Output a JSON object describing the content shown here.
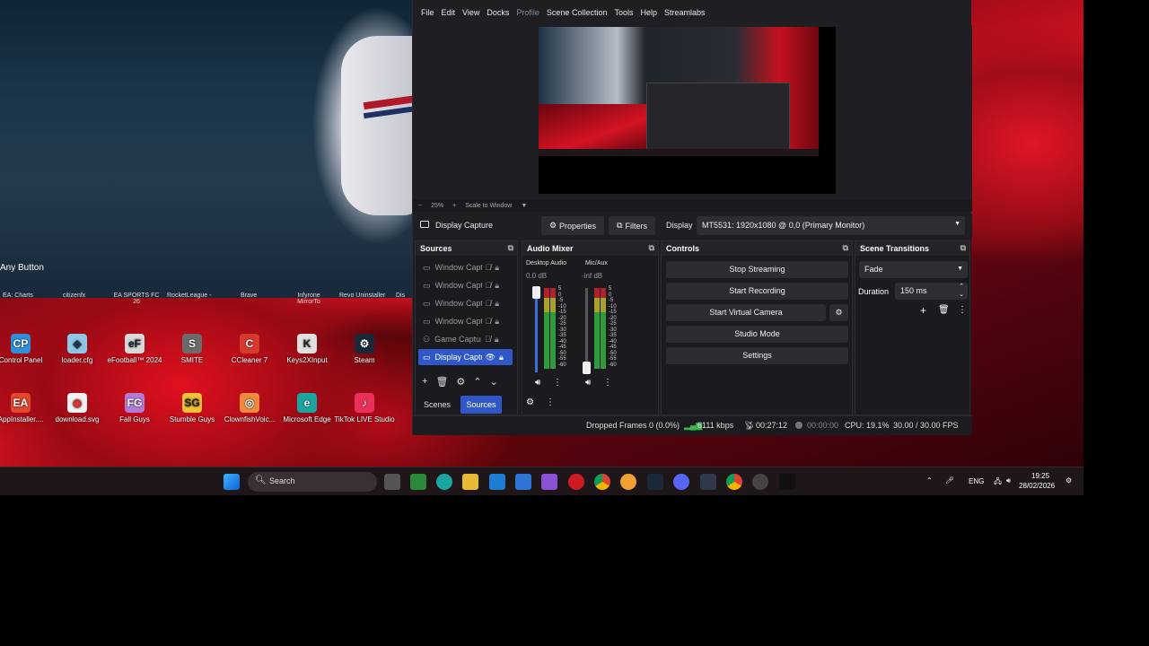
{
  "game": {
    "hint": "Any Button"
  },
  "desktop": {
    "partial_labels": [
      "EA: Charts",
      "citizenfx",
      "EA SPORTS FC 26",
      "RocketLeague -",
      "Brave",
      "Infyrone MirrorTo",
      "Revo Uninstaller",
      "Dis"
    ],
    "icons_row1": [
      {
        "label": "Control Panel",
        "glyph": "CP",
        "color": "#2f8fd8"
      },
      {
        "label": "loader.cfg",
        "glyph": "◆",
        "color": "#8fc6e8"
      },
      {
        "label": "eFootball™ 2024",
        "glyph": "eF",
        "color": "#d9d9d9"
      },
      {
        "label": "SMITE",
        "glyph": "S",
        "color": "#6b6b6b"
      },
      {
        "label": "CCleaner 7",
        "glyph": "C",
        "color": "#d63a2c"
      },
      {
        "label": "Keys2XInput",
        "glyph": "K",
        "color": "#e0e0e0"
      },
      {
        "label": "Steam",
        "glyph": "⚙",
        "color": "#1b2838"
      }
    ],
    "icons_row2": [
      {
        "label": "AppInstaller....",
        "glyph": "EA",
        "color": "#e4462e"
      },
      {
        "label": "download.svg",
        "glyph": "◉",
        "color": "#f1f1f1"
      },
      {
        "label": "Fall Guys",
        "glyph": "FG",
        "color": "#b07ad6"
      },
      {
        "label": "Stumble Guys",
        "glyph": "SG",
        "color": "#f2c13a"
      },
      {
        "label": "ClownfishVoic...",
        "glyph": "◎",
        "color": "#f08a3c"
      },
      {
        "label": "Microsoft Edge",
        "glyph": "e",
        "color": "#1aa5a0"
      },
      {
        "label": "TikTok LIVE Studio",
        "glyph": "♪",
        "color": "#e8305a"
      }
    ]
  },
  "taskbar": {
    "search_placeholder": "Search",
    "tray": {
      "lang": "ENG",
      "time": "19:25",
      "date": "28/02/2026"
    }
  },
  "obs": {
    "menu": [
      "File",
      "Edit",
      "View",
      "Docks",
      "Profile",
      "Scene Collection",
      "Tools",
      "Help",
      "Streamlabs"
    ],
    "zoom": {
      "minus": "−",
      "value": "25%",
      "plus": "+",
      "mode": "Scale to Window",
      "caret": "▼"
    },
    "context": {
      "source_name": "Display Capture",
      "properties": "Properties",
      "filters": "Filters",
      "display_label": "Display",
      "display_value": "MT5531: 1920x1080 @ 0,0 (Primary Monitor)"
    },
    "sources": {
      "title": "Sources",
      "items": [
        {
          "name": "Window Capture",
          "icon": "▭",
          "selected": false
        },
        {
          "name": "Window Capture",
          "icon": "▭",
          "selected": false
        },
        {
          "name": "Window Capture",
          "icon": "▭",
          "selected": false
        },
        {
          "name": "Window Capture",
          "icon": "▭",
          "selected": false
        },
        {
          "name": "Game Capture",
          "icon": "⚇",
          "selected": false
        },
        {
          "name": "Display Capture",
          "icon": "▭",
          "selected": true
        }
      ],
      "tabs": [
        "Scenes",
        "Sources"
      ]
    },
    "mixer": {
      "title": "Audio Mixer",
      "channels": [
        {
          "name": "Desktop Audio",
          "db": "0.0 dB"
        },
        {
          "name": "Mic/Aux",
          "db": "-inf dB"
        }
      ],
      "scale": [
        "5",
        "0",
        "-5",
        "-10",
        "-15",
        "-20",
        "-25",
        "-30",
        "-35",
        "-40",
        "-45",
        "-50",
        "-55",
        "-60"
      ]
    },
    "controls": {
      "title": "Controls",
      "buttons": [
        "Stop Streaming",
        "Start Recording",
        "Start Virtual Camera",
        "Studio Mode",
        "Settings"
      ]
    },
    "transitions": {
      "title": "Scene Transitions",
      "type": "Fade",
      "duration_label": "Duration",
      "duration_value": "150 ms"
    },
    "status": {
      "dropped": "Dropped Frames 0 (0.0%)",
      "kbps": "6111 kbps",
      "stream_time": "00:27:12",
      "rec_time": "00:00:00",
      "cpu": "CPU: 19.1%",
      "fps": "30.00 / 30.00 FPS"
    },
    "colors": {
      "accent": "#2f57c8",
      "live": "#3fb34f"
    }
  }
}
